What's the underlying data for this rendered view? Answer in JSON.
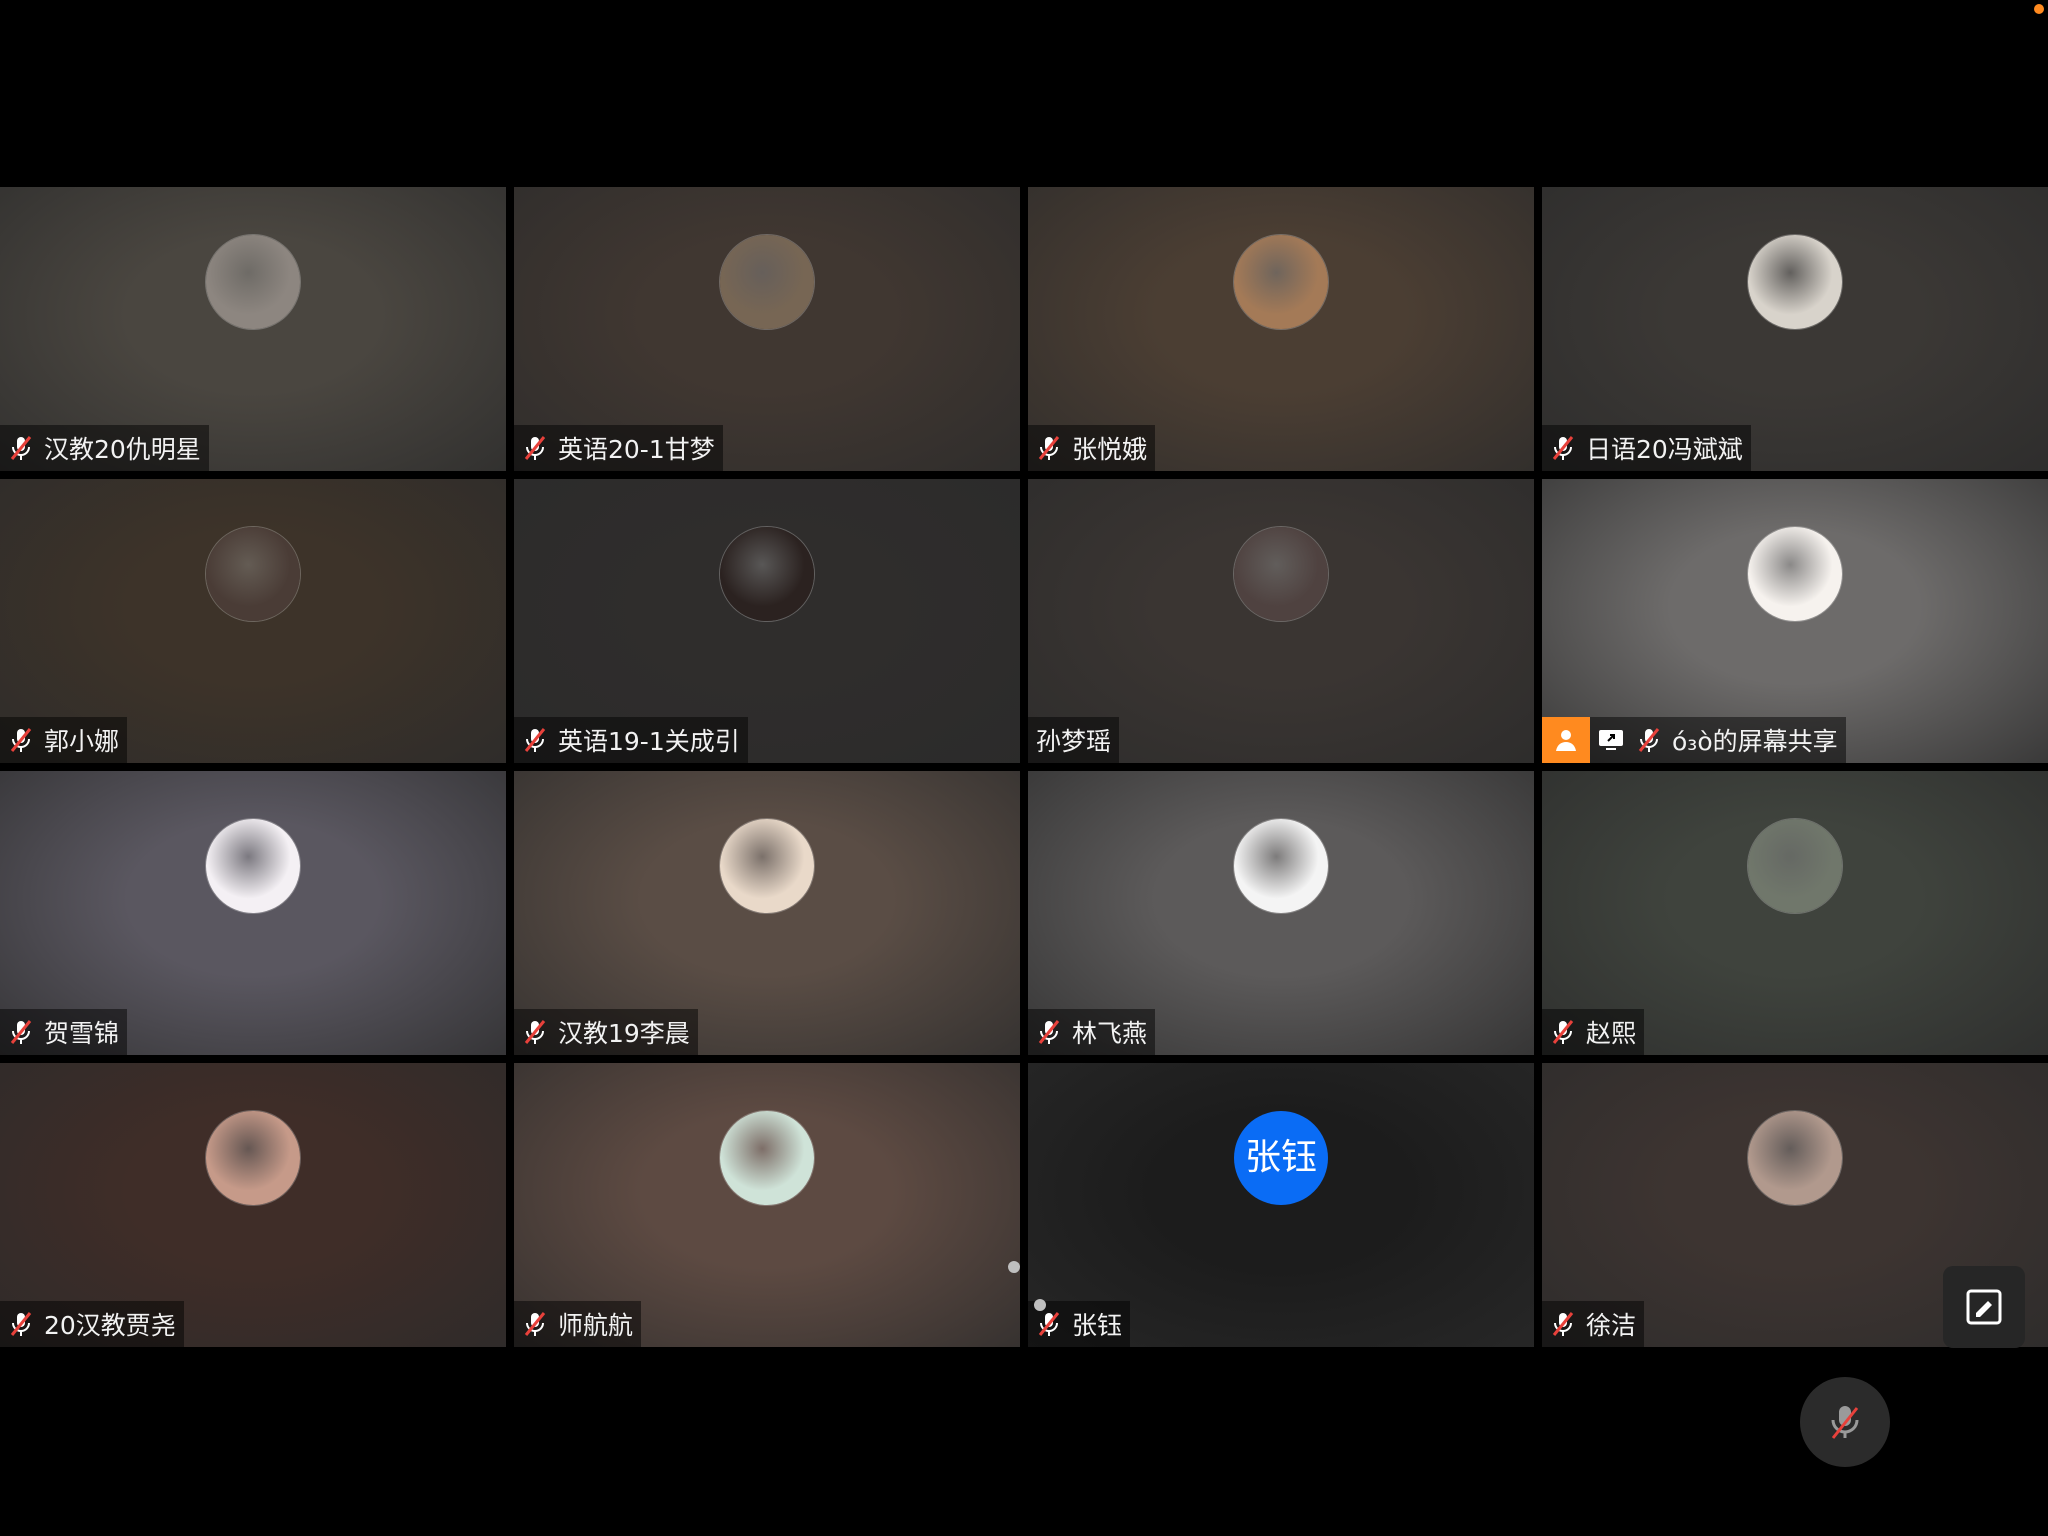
{
  "participants": [
    {
      "name": "汉教20仇明星",
      "muted": true,
      "bg": "#4a4640",
      "avatar": "#8d8680"
    },
    {
      "name": "英语20-1甘梦",
      "muted": true,
      "bg": "#403731",
      "avatar": "#776654"
    },
    {
      "name": "张悦娥",
      "muted": true,
      "bg": "#4b3e33",
      "avatar": "#a47a57"
    },
    {
      "name": "日语20冯斌斌",
      "muted": true,
      "bg": "#3b3835",
      "avatar": "#d8d3cb"
    },
    {
      "name": "郭小娜",
      "muted": true,
      "bg": "#3d3329",
      "avatar": "#4a3c36"
    },
    {
      "name": "英语19-1关成引",
      "muted": true,
      "bg": "#2f2d2c",
      "avatar": "#2b2220"
    },
    {
      "name": "孙梦瑶",
      "muted": false,
      "bg": "#3a3532",
      "avatar": "#4f4240"
    },
    {
      "name": "ό₃ὸ的屏幕共享",
      "muted": true,
      "presenter": true,
      "sharing": true,
      "bg": "#6d6b6a",
      "avatar": "#f6f2ee"
    },
    {
      "name": "贺雪锦",
      "muted": true,
      "bg": "#5a5760",
      "avatar": "#f4f0f4"
    },
    {
      "name": "汉教19李晨",
      "muted": true,
      "bg": "#5a4d45",
      "avatar": "#e9d9c9"
    },
    {
      "name": "林飞燕",
      "muted": true,
      "bg": "#5c5a5a",
      "avatar": "#f4f4f4"
    },
    {
      "name": "赵熙",
      "muted": true,
      "bg": "#3f433d",
      "avatar": "#70776b"
    },
    {
      "name": "20汉教贾尧",
      "muted": true,
      "bg": "#3f2d28",
      "avatar": "#c69a89"
    },
    {
      "name": "师航航",
      "muted": true,
      "bg": "#5d4a42",
      "avatar": "#cfe3d8"
    },
    {
      "name": "张钰",
      "muted": true,
      "bg": "#1c1c1c",
      "avatar_text": "张钰"
    },
    {
      "name": "徐洁",
      "muted": true,
      "bg": "#3d3431",
      "avatar": "#b1998d"
    }
  ],
  "colors": {
    "mute": "#e8413b",
    "presenter": "#ff8a1f",
    "avatar_text_bg": "#0a6cf5"
  },
  "icons": {
    "mute": "mic-muted-icon",
    "share": "screen-share-icon",
    "presenter": "person-icon",
    "float": "edit-window-icon",
    "mic": "mic-off-icon"
  }
}
